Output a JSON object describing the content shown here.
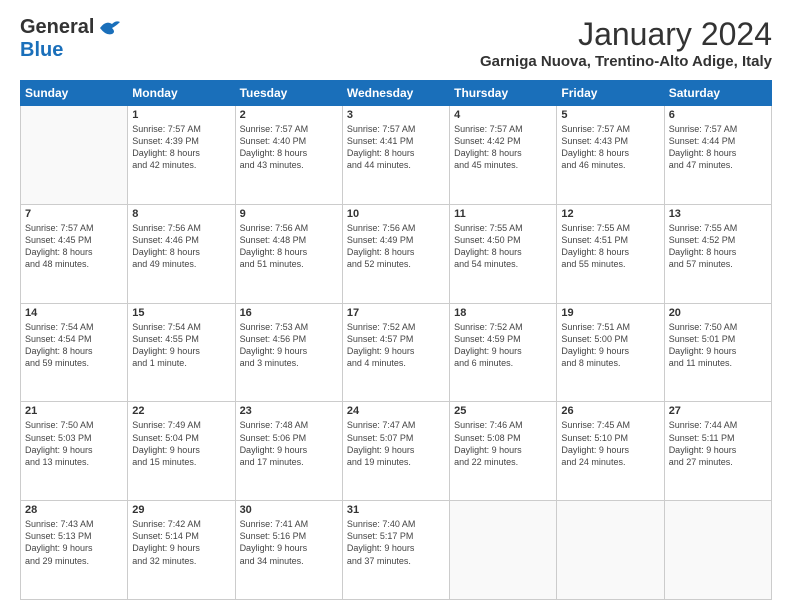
{
  "header": {
    "logo_general": "General",
    "logo_blue": "Blue",
    "month_title": "January 2024",
    "location": "Garniga Nuova, Trentino-Alto Adige, Italy"
  },
  "days_of_week": [
    "Sunday",
    "Monday",
    "Tuesday",
    "Wednesday",
    "Thursday",
    "Friday",
    "Saturday"
  ],
  "weeks": [
    [
      {
        "day": "",
        "info": ""
      },
      {
        "day": "1",
        "info": "Sunrise: 7:57 AM\nSunset: 4:39 PM\nDaylight: 8 hours\nand 42 minutes."
      },
      {
        "day": "2",
        "info": "Sunrise: 7:57 AM\nSunset: 4:40 PM\nDaylight: 8 hours\nand 43 minutes."
      },
      {
        "day": "3",
        "info": "Sunrise: 7:57 AM\nSunset: 4:41 PM\nDaylight: 8 hours\nand 44 minutes."
      },
      {
        "day": "4",
        "info": "Sunrise: 7:57 AM\nSunset: 4:42 PM\nDaylight: 8 hours\nand 45 minutes."
      },
      {
        "day": "5",
        "info": "Sunrise: 7:57 AM\nSunset: 4:43 PM\nDaylight: 8 hours\nand 46 minutes."
      },
      {
        "day": "6",
        "info": "Sunrise: 7:57 AM\nSunset: 4:44 PM\nDaylight: 8 hours\nand 47 minutes."
      }
    ],
    [
      {
        "day": "7",
        "info": "Sunrise: 7:57 AM\nSunset: 4:45 PM\nDaylight: 8 hours\nand 48 minutes."
      },
      {
        "day": "8",
        "info": "Sunrise: 7:56 AM\nSunset: 4:46 PM\nDaylight: 8 hours\nand 49 minutes."
      },
      {
        "day": "9",
        "info": "Sunrise: 7:56 AM\nSunset: 4:48 PM\nDaylight: 8 hours\nand 51 minutes."
      },
      {
        "day": "10",
        "info": "Sunrise: 7:56 AM\nSunset: 4:49 PM\nDaylight: 8 hours\nand 52 minutes."
      },
      {
        "day": "11",
        "info": "Sunrise: 7:55 AM\nSunset: 4:50 PM\nDaylight: 8 hours\nand 54 minutes."
      },
      {
        "day": "12",
        "info": "Sunrise: 7:55 AM\nSunset: 4:51 PM\nDaylight: 8 hours\nand 55 minutes."
      },
      {
        "day": "13",
        "info": "Sunrise: 7:55 AM\nSunset: 4:52 PM\nDaylight: 8 hours\nand 57 minutes."
      }
    ],
    [
      {
        "day": "14",
        "info": "Sunrise: 7:54 AM\nSunset: 4:54 PM\nDaylight: 8 hours\nand 59 minutes."
      },
      {
        "day": "15",
        "info": "Sunrise: 7:54 AM\nSunset: 4:55 PM\nDaylight: 9 hours\nand 1 minute."
      },
      {
        "day": "16",
        "info": "Sunrise: 7:53 AM\nSunset: 4:56 PM\nDaylight: 9 hours\nand 3 minutes."
      },
      {
        "day": "17",
        "info": "Sunrise: 7:52 AM\nSunset: 4:57 PM\nDaylight: 9 hours\nand 4 minutes."
      },
      {
        "day": "18",
        "info": "Sunrise: 7:52 AM\nSunset: 4:59 PM\nDaylight: 9 hours\nand 6 minutes."
      },
      {
        "day": "19",
        "info": "Sunrise: 7:51 AM\nSunset: 5:00 PM\nDaylight: 9 hours\nand 8 minutes."
      },
      {
        "day": "20",
        "info": "Sunrise: 7:50 AM\nSunset: 5:01 PM\nDaylight: 9 hours\nand 11 minutes."
      }
    ],
    [
      {
        "day": "21",
        "info": "Sunrise: 7:50 AM\nSunset: 5:03 PM\nDaylight: 9 hours\nand 13 minutes."
      },
      {
        "day": "22",
        "info": "Sunrise: 7:49 AM\nSunset: 5:04 PM\nDaylight: 9 hours\nand 15 minutes."
      },
      {
        "day": "23",
        "info": "Sunrise: 7:48 AM\nSunset: 5:06 PM\nDaylight: 9 hours\nand 17 minutes."
      },
      {
        "day": "24",
        "info": "Sunrise: 7:47 AM\nSunset: 5:07 PM\nDaylight: 9 hours\nand 19 minutes."
      },
      {
        "day": "25",
        "info": "Sunrise: 7:46 AM\nSunset: 5:08 PM\nDaylight: 9 hours\nand 22 minutes."
      },
      {
        "day": "26",
        "info": "Sunrise: 7:45 AM\nSunset: 5:10 PM\nDaylight: 9 hours\nand 24 minutes."
      },
      {
        "day": "27",
        "info": "Sunrise: 7:44 AM\nSunset: 5:11 PM\nDaylight: 9 hours\nand 27 minutes."
      }
    ],
    [
      {
        "day": "28",
        "info": "Sunrise: 7:43 AM\nSunset: 5:13 PM\nDaylight: 9 hours\nand 29 minutes."
      },
      {
        "day": "29",
        "info": "Sunrise: 7:42 AM\nSunset: 5:14 PM\nDaylight: 9 hours\nand 32 minutes."
      },
      {
        "day": "30",
        "info": "Sunrise: 7:41 AM\nSunset: 5:16 PM\nDaylight: 9 hours\nand 34 minutes."
      },
      {
        "day": "31",
        "info": "Sunrise: 7:40 AM\nSunset: 5:17 PM\nDaylight: 9 hours\nand 37 minutes."
      },
      {
        "day": "",
        "info": ""
      },
      {
        "day": "",
        "info": ""
      },
      {
        "day": "",
        "info": ""
      }
    ]
  ]
}
